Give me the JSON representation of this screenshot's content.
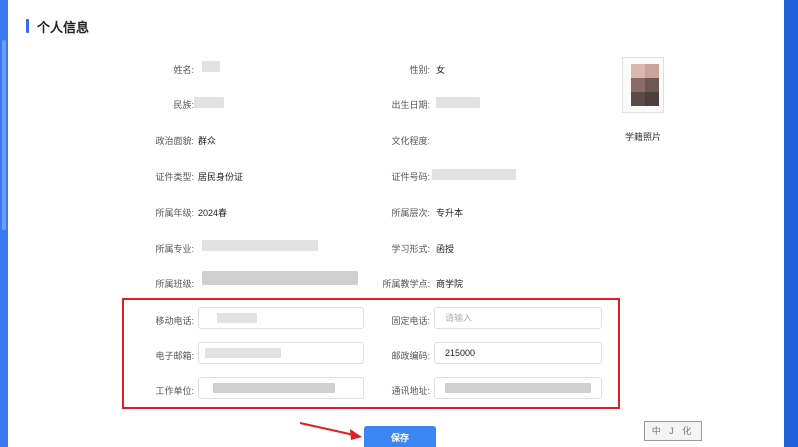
{
  "section": {
    "title": "个人信息"
  },
  "info": {
    "name_label": "姓名:",
    "gender_label": "性别:",
    "gender_value": "女",
    "ethnicity_label": "民族:",
    "birth_label": "出生日期:",
    "politics_label": "政治面貌:",
    "politics_value": "群众",
    "education_label": "文化程度:",
    "id_type_label": "证件类型:",
    "id_type_value": "居民身份证",
    "id_number_label": "证件号码:",
    "grade_label": "所属年级:",
    "grade_value": "2024春",
    "level_label": "所属层次:",
    "level_value": "专升本",
    "major_label": "所属专业:",
    "study_form_label": "学习形式:",
    "study_form_value": "函授",
    "class_label": "所属班级:",
    "center_label": "所属教学点:",
    "center_value": "商学院"
  },
  "photo": {
    "caption": "学籍照片"
  },
  "form": {
    "mobile_label": "移动电话:",
    "phone_label": "固定电话:",
    "phone_placeholder": "请输入",
    "email_label": "电子邮箱:",
    "postcode_label": "邮政编码:",
    "postcode_value": "215000",
    "work_label": "工作单位:",
    "address_label": "通讯地址:"
  },
  "actions": {
    "save_label": "保存"
  },
  "stamp": {
    "text": "中 J 化"
  },
  "colors": {
    "accent": "#2f6fe0",
    "highlight": "#e02020",
    "button": "#3a86f5"
  }
}
